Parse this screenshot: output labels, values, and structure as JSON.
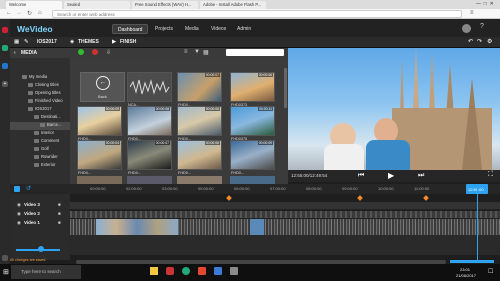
{
  "browser": {
    "tabs": [
      {
        "label": "Welcome",
        "active": true
      },
      {
        "label": "Sealed",
        "active": false
      },
      {
        "label": "Free Sound Effects (WAV) H...",
        "active": false
      },
      {
        "label": "Adobe - Install Adobe Flash P...",
        "active": false
      }
    ],
    "address_placeholder": "Search or enter web address"
  },
  "app": {
    "logo": "WeVideo",
    "nav": [
      "Dashboard",
      "Projects",
      "Media",
      "Videos",
      "Admin"
    ],
    "project_name": "IOS2017",
    "themes_label": "THEMES",
    "finish_label": "FINISH",
    "media_label": "MEDIA"
  },
  "folders": [
    "My media",
    "Closing titles",
    "Opening titles",
    "Finished Video",
    "IOS2017",
    "Destinati...",
    "Barce...",
    "Interior",
    "Comment",
    "Golf",
    "Rowrider",
    "Exterior"
  ],
  "media_items": [
    {
      "label": "Back",
      "duration": ""
    },
    {
      "label": "NCA...",
      "duration": ""
    },
    {
      "label": "FHD0...",
      "duration": "00:00:07"
    },
    {
      "label": "FHD0373",
      "duration": "00:00:06"
    },
    {
      "label": "FHD0...",
      "duration": "00:00:09"
    },
    {
      "label": "FHD0...",
      "duration": "00:00:08"
    },
    {
      "label": "FHD0...",
      "duration": "00:00:05"
    },
    {
      "label": "FHD0375",
      "duration": "00:00:11"
    },
    {
      "label": "FHD0...",
      "duration": "00:00:04"
    },
    {
      "label": "FHD0...",
      "duration": "00:00:07"
    },
    {
      "label": "FHD0...",
      "duration": "00:00:06"
    },
    {
      "label": "FHD0...",
      "duration": "00:00:09"
    },
    {
      "label": "FHD0...",
      "duration": "00:00:08"
    },
    {
      "label": "FHD0167",
      "duration": "00:00:05"
    },
    {
      "label": "FHD0...",
      "duration": "00:00:07"
    },
    {
      "label": "FHD0...",
      "duration": "00:00:03"
    }
  ],
  "preview": {
    "timecode": "12:55:00/12:49:54"
  },
  "timeline": {
    "ruler": [
      "00:00:00",
      "02:00:00",
      "03:00:00",
      "05:00:00",
      "06:00:00",
      "07:00:00",
      "08:00:00",
      "09:00:00",
      "10:00:00",
      "11:00:00"
    ],
    "playhead": "12:55:00",
    "tracks": [
      "Video 3",
      "Video 2",
      "Video 1"
    ],
    "status": "All changes are saved"
  },
  "taskbar": {
    "search_placeholder": "Type here to search",
    "time": "23:01",
    "date": "21/06/2017"
  },
  "colors": {
    "accent": "#2ea3f2",
    "logo": "#7ed6ff",
    "timeline_marker": "#f28a2e"
  }
}
